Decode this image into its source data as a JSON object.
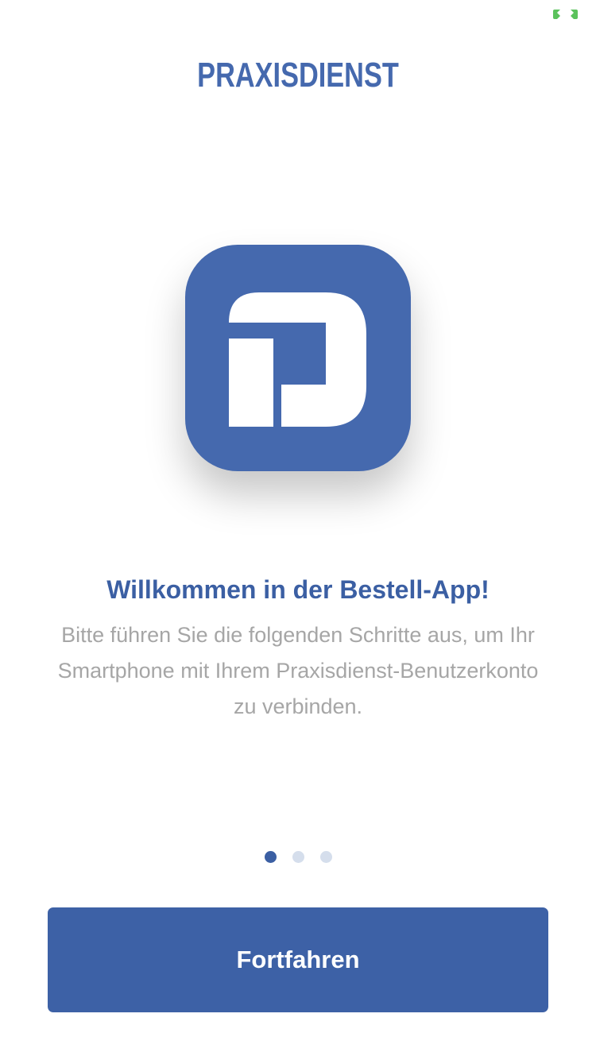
{
  "status": {
    "icon": "fullscreen-toggle-icon",
    "color": "#5bc25c"
  },
  "header": {
    "brand": "PRAXISDIENST",
    "brand_color": "#4569ae"
  },
  "logo": {
    "icon": "praxisdienst-app-logo-icon",
    "color": "#4569ae"
  },
  "welcome": {
    "title": "Willkommen in der Bestell-App!",
    "body": "Bitte führen Sie die folgenden Schritte aus, um Ihr Smartphone mit Ihrem Praxisdienst-Benutzerkonto zu verbinden."
  },
  "pager": {
    "current_page": 1,
    "total_pages": 3,
    "active_color": "#3b5fa3",
    "inactive_color": "#d5deec"
  },
  "actions": {
    "continue_label": "Fortfahren",
    "button_color": "#3d61a6"
  }
}
